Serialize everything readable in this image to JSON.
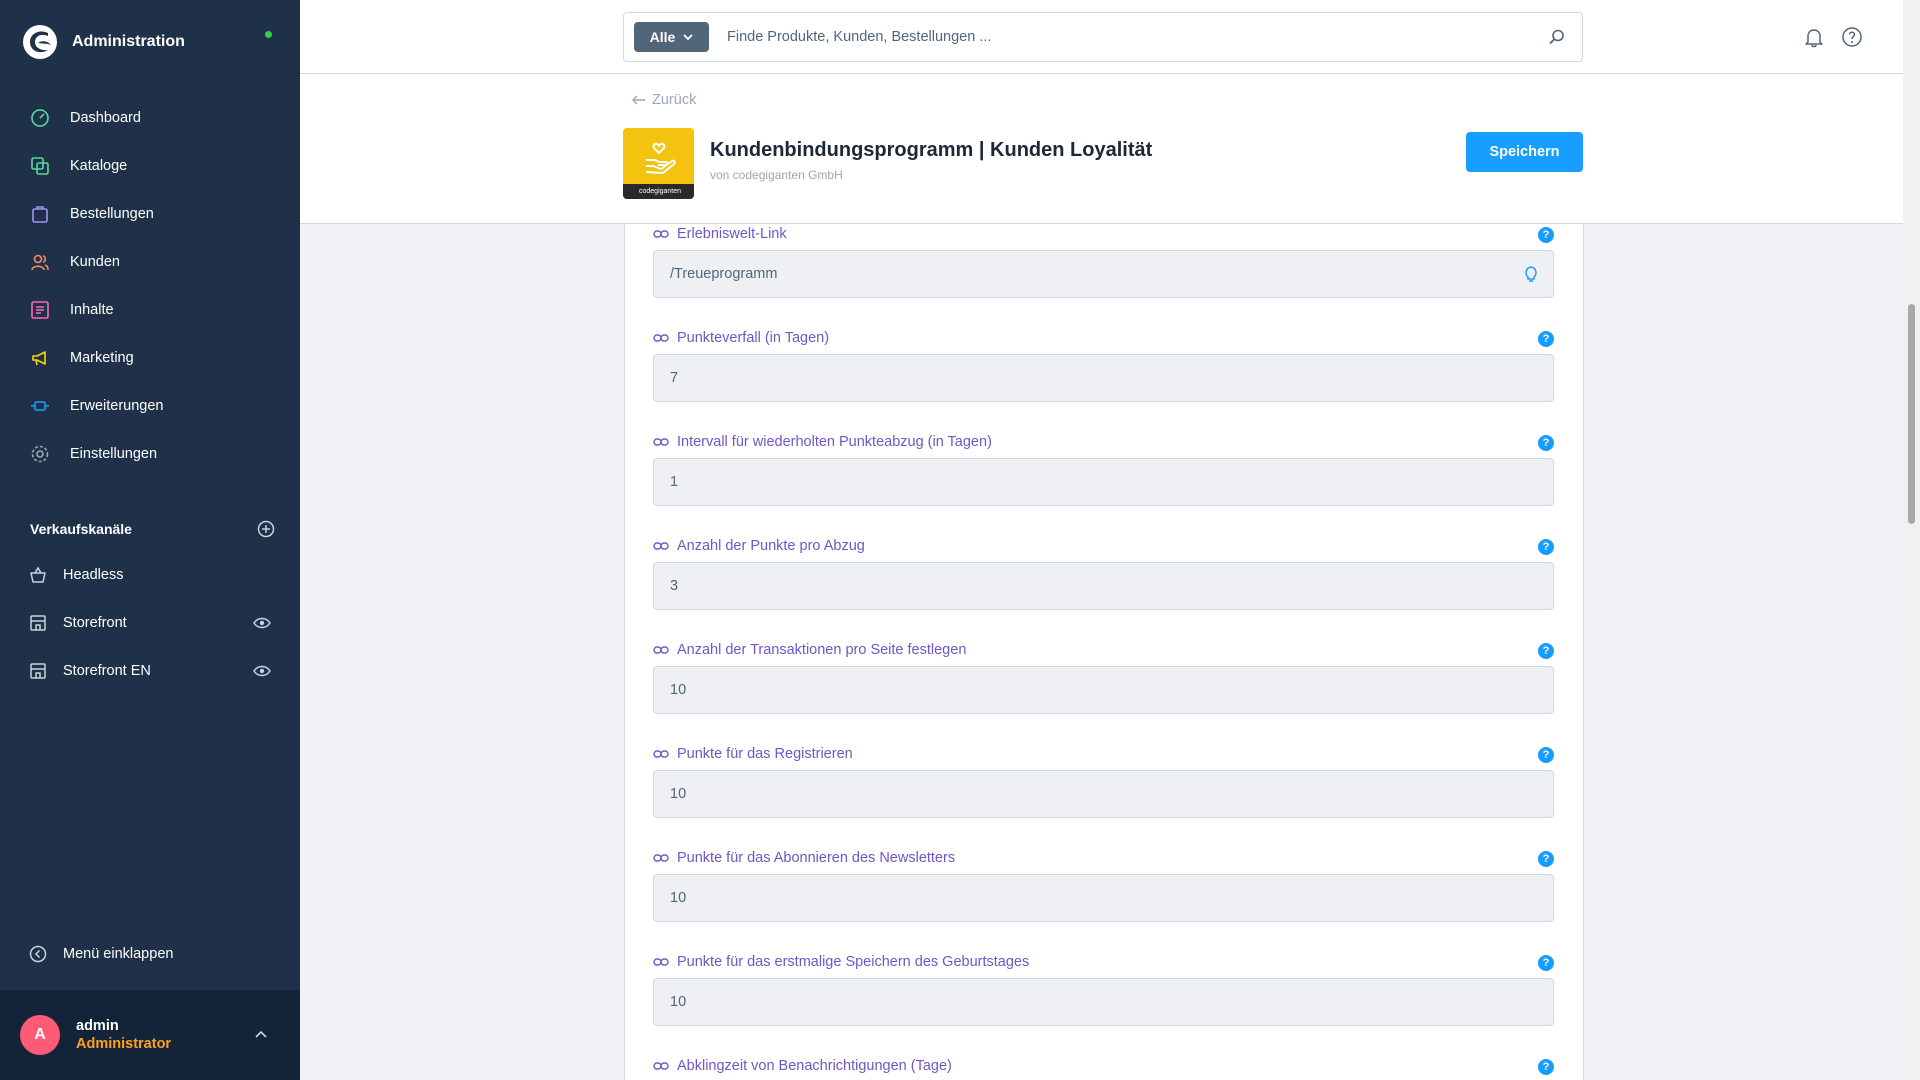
{
  "brand": {
    "title": "Administration"
  },
  "nav": [
    {
      "label": "Dashboard",
      "icon": "dashboard-icon",
      "color": "#57d9a3"
    },
    {
      "label": "Kataloge",
      "icon": "catalog-icon",
      "color": "#57d9a3"
    },
    {
      "label": "Bestellungen",
      "icon": "bag-icon",
      "color": "#a092f0"
    },
    {
      "label": "Kunden",
      "icon": "users-icon",
      "color": "#f88962"
    },
    {
      "label": "Inhalte",
      "icon": "content-icon",
      "color": "#ff68b4"
    },
    {
      "label": "Marketing",
      "icon": "megaphone-icon",
      "color": "#ffd700"
    },
    {
      "label": "Erweiterungen",
      "icon": "plug-icon",
      "color": "#189eff"
    },
    {
      "label": "Einstellungen",
      "icon": "settings-icon",
      "color": "#9aa8b5"
    }
  ],
  "sales_channels": {
    "heading": "Verkaufskanäle",
    "items": [
      {
        "label": "Headless",
        "icon": "basket-icon",
        "visible_toggle": false
      },
      {
        "label": "Storefront",
        "icon": "storefront-icon",
        "visible_toggle": true
      },
      {
        "label": "Storefront EN",
        "icon": "storefront-icon",
        "visible_toggle": true
      }
    ]
  },
  "sidebar_footer": {
    "collapse_label": "Menü einklappen"
  },
  "user": {
    "initial": "A",
    "name": "admin",
    "role": "Administrator"
  },
  "search": {
    "type_label": "Alle",
    "placeholder": "Finde Produkte, Kunden, Bestellungen ..."
  },
  "header": {
    "back_label": "Zurück",
    "plugin_title": "Kundenbindungsprogramm | Kunden Loyalität",
    "plugin_vendor": "von codegiganten GmbH",
    "plugin_icon_strip": "codegiganten",
    "save_label": "Speichern"
  },
  "fields": [
    {
      "label": "Erlebniswelt-Link",
      "value": "/Treueprogramm",
      "suffix": "lightbulb-icon"
    },
    {
      "label": "Punkteverfall (in Tagen)",
      "value": "7"
    },
    {
      "label": "Intervall für wiederholten Punkteabzug (in Tagen)",
      "value": "1"
    },
    {
      "label": "Anzahl der Punkte pro Abzug",
      "value": "3"
    },
    {
      "label": "Anzahl der Transaktionen pro Seite festlegen",
      "value": "10"
    },
    {
      "label": "Punkte für das Registrieren",
      "value": "10"
    },
    {
      "label": "Punkte für das Abonnieren des Newsletters",
      "value": "10"
    },
    {
      "label": "Punkte für das erstmalige Speichern des Geburtstages",
      "value": "10"
    },
    {
      "label": "Abklingzeit von Benachrichtigungen (Tage)",
      "value": ""
    }
  ],
  "help_glyph": "?",
  "colors": {
    "sidebar": "#1f3148",
    "accent": "#189eff",
    "label": "#6e57c7",
    "role": "#ffa01e",
    "online": "#37d046"
  }
}
